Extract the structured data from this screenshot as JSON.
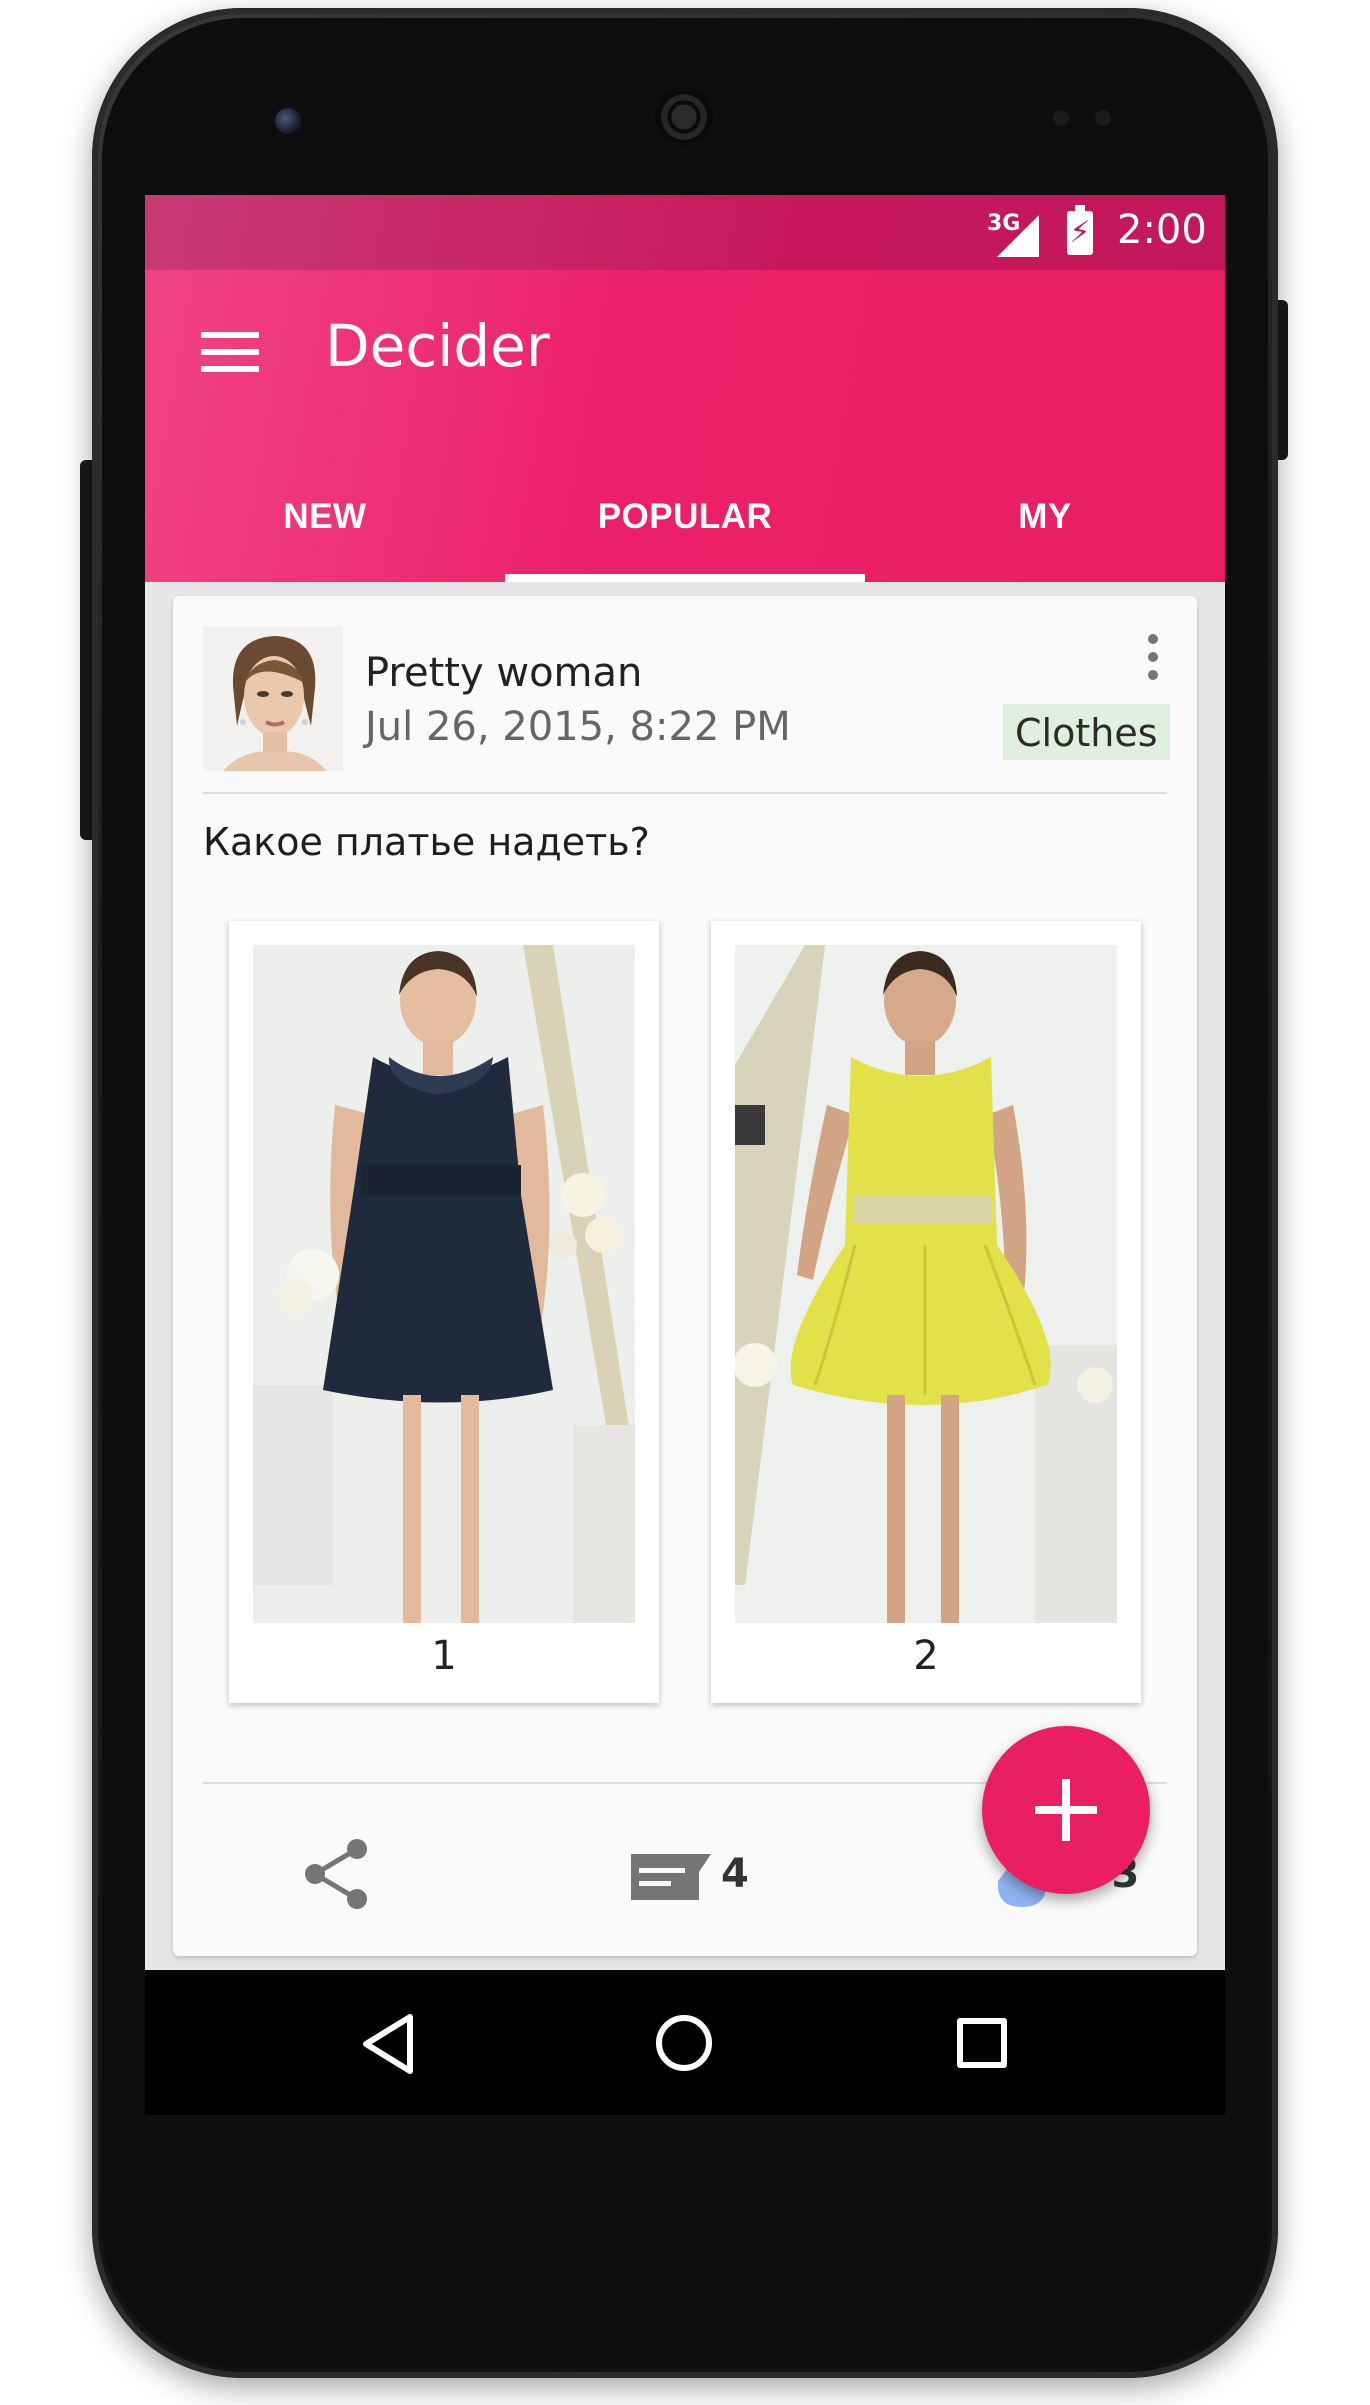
{
  "status_bar": {
    "network": "3G",
    "time": "2:00"
  },
  "app_bar": {
    "title": "Decider",
    "tabs": [
      {
        "label": "NEW"
      },
      {
        "label": "POPULAR"
      },
      {
        "label": "MY"
      }
    ],
    "selected_tab": "POPULAR"
  },
  "post": {
    "user_name": "Pretty woman",
    "date": "Jul 26, 2015, 8:22 PM",
    "category": "Clothes",
    "question": "Какое платье надеть?",
    "options": [
      {
        "label": "1",
        "dress_color": "#1f2a3c"
      },
      {
        "label": "2",
        "dress_color": "#e3e14a"
      }
    ],
    "comment_count": "4",
    "vote_count": "+3"
  },
  "colors": {
    "accent": "#e91e63",
    "status_bar": "#c2185b",
    "tag_background": "#dff0de"
  },
  "icons": {
    "menu": "hamburger-icon",
    "overflow": "more-vert-icon",
    "share": "share-icon",
    "comment": "comment-icon",
    "vote": "vote-icon",
    "fab": "plus-icon",
    "nav_back": "back-triangle-icon",
    "nav_home": "home-circle-icon",
    "nav_recents": "recents-square-icon"
  }
}
